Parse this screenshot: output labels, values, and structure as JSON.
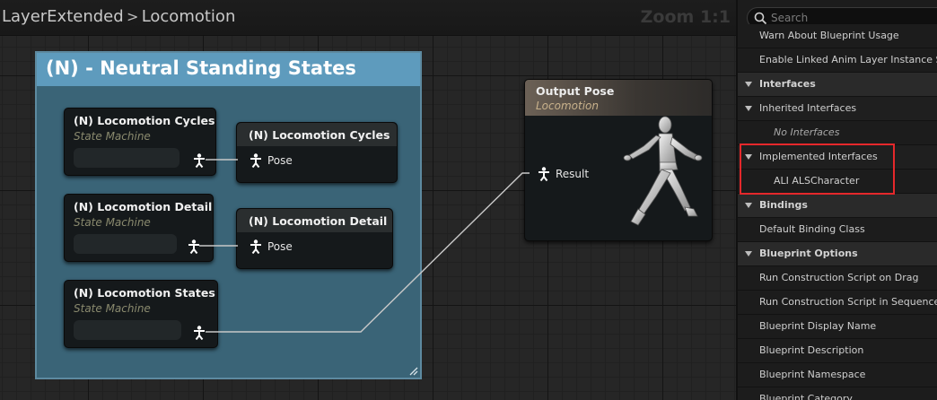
{
  "graph": {
    "breadcrumb": [
      "LayerExtended",
      "Locomotion"
    ],
    "breadcrumb_separator": ">",
    "zoom": "Zoom 1:1",
    "comment_title": "(N) - Neutral Standing States",
    "state_machines": [
      {
        "title": "(N) Locomotion Cycles",
        "subtitle": "State Machine"
      },
      {
        "title": "(N) Locomotion Detail",
        "subtitle": "State Machine"
      },
      {
        "title": "(N) Locomotion States",
        "subtitle": "State Machine"
      }
    ],
    "pose_nodes": [
      {
        "title": "(N) Locomotion Cycles",
        "pin_label": "Pose"
      },
      {
        "title": "(N) Locomotion Detail",
        "pin_label": "Pose"
      }
    ],
    "output": {
      "title": "Output Pose",
      "subtitle": "Locomotion",
      "pin_label": "Result"
    },
    "colors": {
      "comment_header": "#5e9bbd",
      "comment_body": "#3a6477",
      "wire": "#c8c8c8"
    }
  },
  "details": {
    "search_placeholder": "Search",
    "rows": [
      {
        "type": "item",
        "label": "Warn About Blueprint Usage"
      },
      {
        "type": "item",
        "label": "Enable Linked Anim Layer Instance Shar"
      },
      {
        "type": "cat",
        "label": "Interfaces"
      },
      {
        "type": "sub",
        "label": "Inherited Interfaces"
      },
      {
        "type": "item2",
        "label": "No Interfaces"
      },
      {
        "type": "sub",
        "label": "Implemented Interfaces"
      },
      {
        "type": "item2",
        "label": "ALI ALSCharacter"
      },
      {
        "type": "cat",
        "label": "Bindings"
      },
      {
        "type": "item",
        "label": "Default Binding Class"
      },
      {
        "type": "cat",
        "label": "Blueprint Options"
      },
      {
        "type": "item",
        "label": "Run Construction Script on Drag"
      },
      {
        "type": "item",
        "label": "Run Construction Script in Sequencer"
      },
      {
        "type": "item",
        "label": "Blueprint Display Name"
      },
      {
        "type": "item",
        "label": "Blueprint Description"
      },
      {
        "type": "item",
        "label": "Blueprint Namespace"
      },
      {
        "type": "item",
        "label": "Blueprint Category"
      }
    ],
    "highlight_color": "#e5282b"
  }
}
